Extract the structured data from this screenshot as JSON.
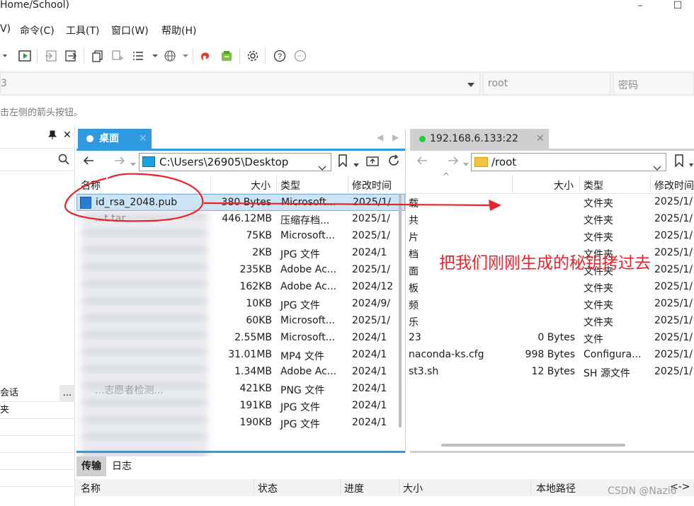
{
  "window": {
    "title": "Home/School)",
    "minimize": "–",
    "maximize": "☐"
  },
  "menu": [
    "V)",
    "命令(C)",
    "工具(T)",
    "窗口(W)",
    "帮助(H)"
  ],
  "toolbar_icons": [
    "arrow-dropdown-icon",
    "run-icon",
    "session-in-icon",
    "session-out-icon",
    "copy-icon",
    "copy-add-icon",
    "list-icon",
    "globe-icon",
    "xshell-icon",
    "xftp-icon",
    "settings-icon",
    "help-icon",
    "chat-icon"
  ],
  "connection": {
    "host_fragment": "3",
    "user_placeholder": "root",
    "password_placeholder": "密码"
  },
  "hint": "击左侧的箭头按钮。",
  "sidebar": {
    "pin": "📌",
    "close": "✕",
    "sessions_label": "会话",
    "more": "...",
    "folder_label": "夹"
  },
  "local_pane": {
    "tab_label": "桌面",
    "path": "C:\\Users\\26905\\Desktop",
    "columns": [
      "名称",
      "大小",
      "类型",
      "修改时间"
    ],
    "rows": [
      {
        "name": "id_rsa_2048.pub",
        "size": "380 Bytes",
        "type": "Microsoft...",
        "date": "2025/1/"
      },
      {
        "name": "...t.tar",
        "size": "446.12MB",
        "type": "压缩存档...",
        "date": "2025/1/"
      },
      {
        "name": "",
        "size": "75KB",
        "type": "Microsoft...",
        "date": "2025/1/"
      },
      {
        "name": "",
        "size": "2KB",
        "type": "JPG 文件",
        "date": "2024/1"
      },
      {
        "name": "",
        "size": "235KB",
        "type": "Adobe Ac...",
        "date": "2025/1/"
      },
      {
        "name": "",
        "size": "162KB",
        "type": "Adobe Ac...",
        "date": "2024/12"
      },
      {
        "name": "",
        "size": "10KB",
        "type": "JPG 文件",
        "date": "2024/9/"
      },
      {
        "name": "",
        "size": "60KB",
        "type": "Microsoft...",
        "date": "2025/1/"
      },
      {
        "name": "",
        "size": "2.55MB",
        "type": "Microsoft...",
        "date": "2024/1"
      },
      {
        "name": "",
        "size": "31.01MB",
        "type": "MP4 文件",
        "date": "2024/1"
      },
      {
        "name": "",
        "size": "1.34MB",
        "type": "Adobe Ac...",
        "date": "2024/1"
      },
      {
        "name": "...志愿者检测...",
        "size": "421KB",
        "type": "PNG 文件",
        "date": "2024/1"
      },
      {
        "name": "",
        "size": "191KB",
        "type": "JPG 文件",
        "date": "2024/1"
      },
      {
        "name": "",
        "size": "190KB",
        "type": "JPG 文件",
        "date": "2024/1"
      }
    ]
  },
  "remote_pane": {
    "tab_label": "192.168.6.133:22",
    "path": "/root",
    "columns": [
      "",
      "大小",
      "类型",
      "修改时间"
    ],
    "rows": [
      {
        "name": "载",
        "size": "",
        "type": "文件夹",
        "date": "2025/1/"
      },
      {
        "name": "共",
        "size": "",
        "type": "文件夹",
        "date": "2025/1/"
      },
      {
        "name": "片",
        "size": "",
        "type": "文件夹",
        "date": "2025/1/"
      },
      {
        "name": "档",
        "size": "",
        "type": "文件夹",
        "date": "2025/1/"
      },
      {
        "name": "面",
        "size": "",
        "type": "文件夹",
        "date": "2025/1/"
      },
      {
        "name": "板",
        "size": "",
        "type": "文件夹",
        "date": "2025/1/"
      },
      {
        "name": "频",
        "size": "",
        "type": "文件夹",
        "date": "2025/1/"
      },
      {
        "name": "乐",
        "size": "",
        "type": "文件夹",
        "date": "2025/1/"
      },
      {
        "name": "23",
        "size": "0 Bytes",
        "type": "文件",
        "date": "2025/1/"
      },
      {
        "name": "naconda-ks.cfg",
        "size": "998 Bytes",
        "type": "Configura...",
        "date": "2025/1/"
      },
      {
        "name": "st3.sh",
        "size": "12 Bytes",
        "type": "SH 源文件",
        "date": "2025/1/"
      }
    ]
  },
  "transfer_panel": {
    "tabs": [
      "传输",
      "日志"
    ],
    "columns": [
      "名称",
      "状态",
      "进度",
      "大小",
      "本地路径",
      "<->"
    ]
  },
  "annotation": "把我们刚刚生成的秘钥拷过去",
  "watermark": "CSDN @Nazi6",
  "colors": {
    "tab_active": "#2e9ae0",
    "tab_inactive": "#cfcfcf",
    "green_dot": "#27c93f",
    "annotation": "#e8232b",
    "selection": "#cce4f7"
  }
}
